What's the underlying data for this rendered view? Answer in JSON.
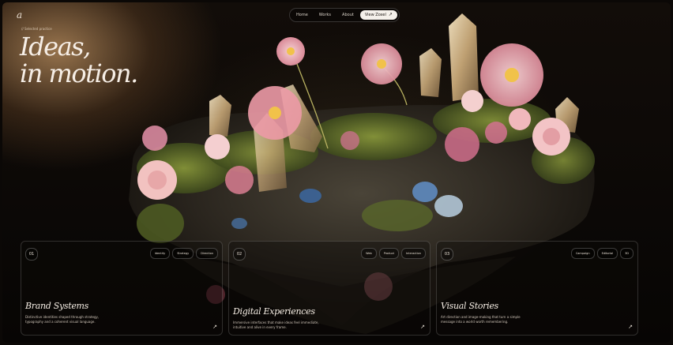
{
  "brand": {
    "logo": "a"
  },
  "nav": {
    "items": [
      "Home",
      "Works",
      "About"
    ],
    "cta_label": "View Zoxel",
    "cta_icon": "arrow-up-right-icon"
  },
  "hero": {
    "eyebrow": "// Selected practice",
    "title_line1": "Ideas,",
    "title_line2": "in motion."
  },
  "cards": [
    {
      "number": "01",
      "tags": [
        "Identity",
        "Strategy",
        "Direction"
      ],
      "title": "Brand Systems",
      "description": "Distinctive identities shaped through strategy, typography and a coherent visual language."
    },
    {
      "number": "02",
      "tags": [
        "Web",
        "Product",
        "Interaction"
      ],
      "title": "Digital Experiences",
      "description": "Immersive interfaces that make ideas feel immediate, intuitive and alive in every frame."
    },
    {
      "number": "03",
      "tags": [
        "Campaign",
        "Editorial",
        "3D"
      ],
      "title": "Visual Stories",
      "description": "Art direction and image-making that turn a simple message into a world worth remembering."
    }
  ],
  "colors": {
    "background": "#0b0806",
    "accent_glow": "#c49664",
    "text": "#f3ece4"
  }
}
